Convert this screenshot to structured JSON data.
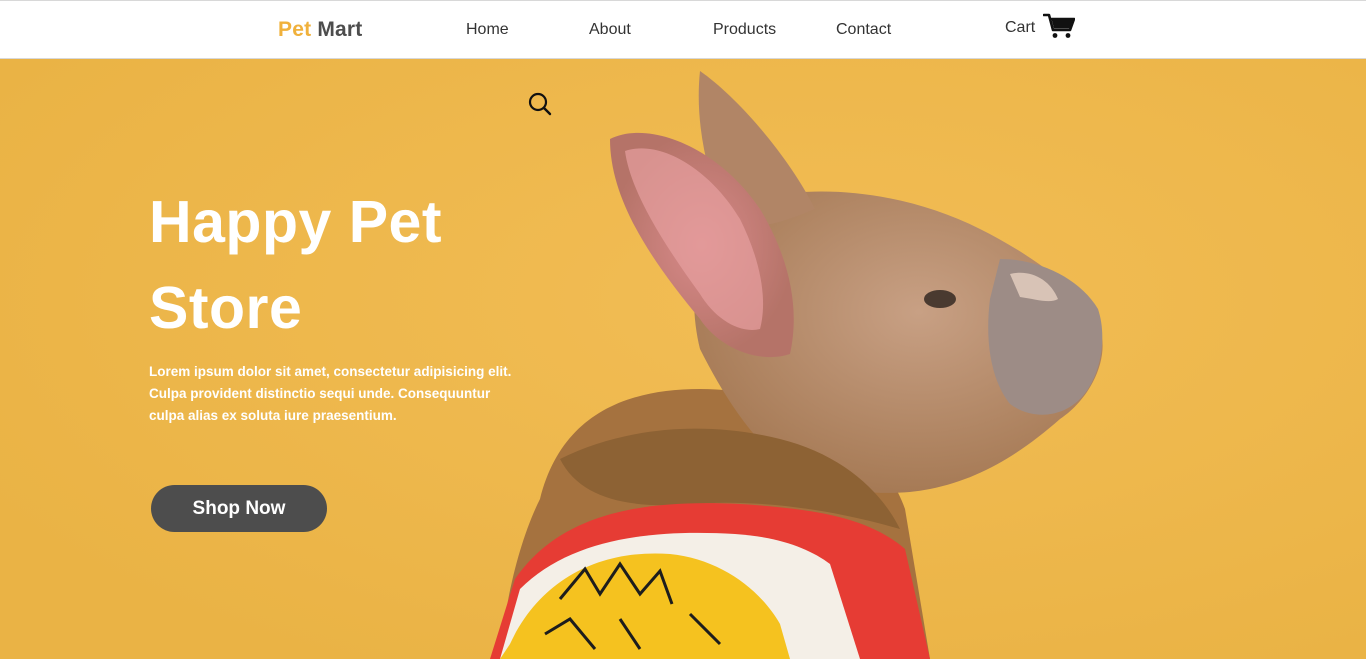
{
  "brand": {
    "part1": "Pet",
    "part2": "Mart"
  },
  "nav": {
    "home": "Home",
    "about": "About",
    "products": "Products",
    "contact": "Contact",
    "cart": "Cart"
  },
  "icons": {
    "cart": "cart-icon",
    "search": "search-icon"
  },
  "hero": {
    "title": "Happy Pet Store",
    "text": "Lorem ipsum dolor sit amet, consectetur adipisicing elit. Culpa provident distinctio sequi unde. Consequuntur culpa alias ex soluta iure praesentium.",
    "button": "Shop Now"
  },
  "colors": {
    "accent": "#f0b13c",
    "hero_background": "#eeb74b",
    "button": "#4d4d4d",
    "text_dark": "#333333"
  }
}
